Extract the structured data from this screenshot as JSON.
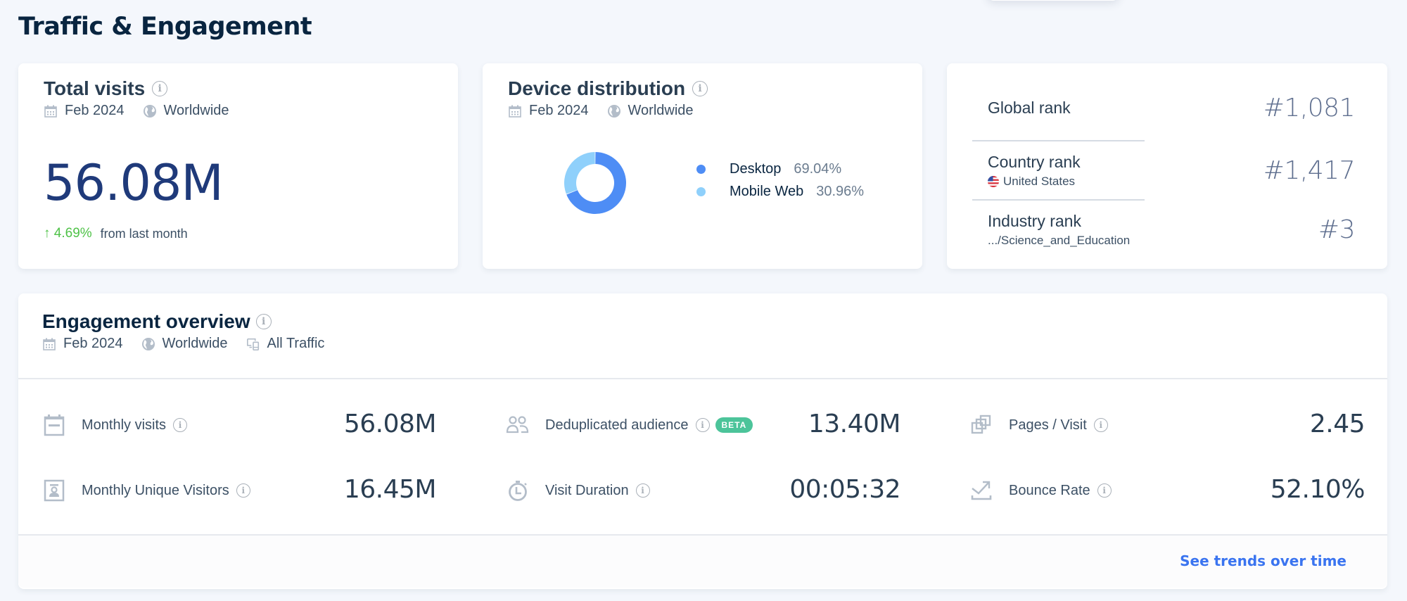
{
  "page": {
    "title": "Traffic & Engagement"
  },
  "total_visits": {
    "title": "Total visits",
    "period": "Feb 2024",
    "region": "Worldwide",
    "value": "56.08M",
    "change": "4.69%",
    "change_direction": "up",
    "change_suffix": "from last month"
  },
  "device_distribution": {
    "title": "Device distribution",
    "period": "Feb 2024",
    "region": "Worldwide",
    "items": [
      {
        "label": "Desktop",
        "value": "69.04%",
        "percent": 69.04,
        "color": "#4e8df5"
      },
      {
        "label": "Mobile Web",
        "value": "30.96%",
        "percent": 30.96,
        "color": "#8fd0fb"
      }
    ]
  },
  "ranks": {
    "global": {
      "label": "Global rank",
      "value": "#1,081"
    },
    "country": {
      "label": "Country rank",
      "sub": "United States",
      "value": "#1,417"
    },
    "industry": {
      "label": "Industry rank",
      "sub": ".../Science_and_Education",
      "value": "#3"
    }
  },
  "engagement": {
    "title": "Engagement overview",
    "period": "Feb 2024",
    "region": "Worldwide",
    "traffic": "All Traffic",
    "metrics": [
      {
        "label": "Monthly visits",
        "value": "56.08M",
        "icon": "calendar-icon"
      },
      {
        "label": "Deduplicated audience",
        "value": "13.40M",
        "icon": "audience-icon",
        "badge": "BETA"
      },
      {
        "label": "Pages / Visit",
        "value": "2.45",
        "icon": "pages-icon"
      },
      {
        "label": "Monthly Unique Visitors",
        "value": "16.45M",
        "icon": "visitor-icon"
      },
      {
        "label": "Visit Duration",
        "value": "00:05:32",
        "icon": "stopwatch-icon"
      },
      {
        "label": "Bounce Rate",
        "value": "52.10%",
        "icon": "bounce-icon"
      }
    ],
    "footer_link": "See trends over time"
  },
  "colors": {
    "accent": "#3a74f0",
    "positive": "#4fc248",
    "beta": "#4cc49a",
    "big_number": "#1f3a7a"
  }
}
